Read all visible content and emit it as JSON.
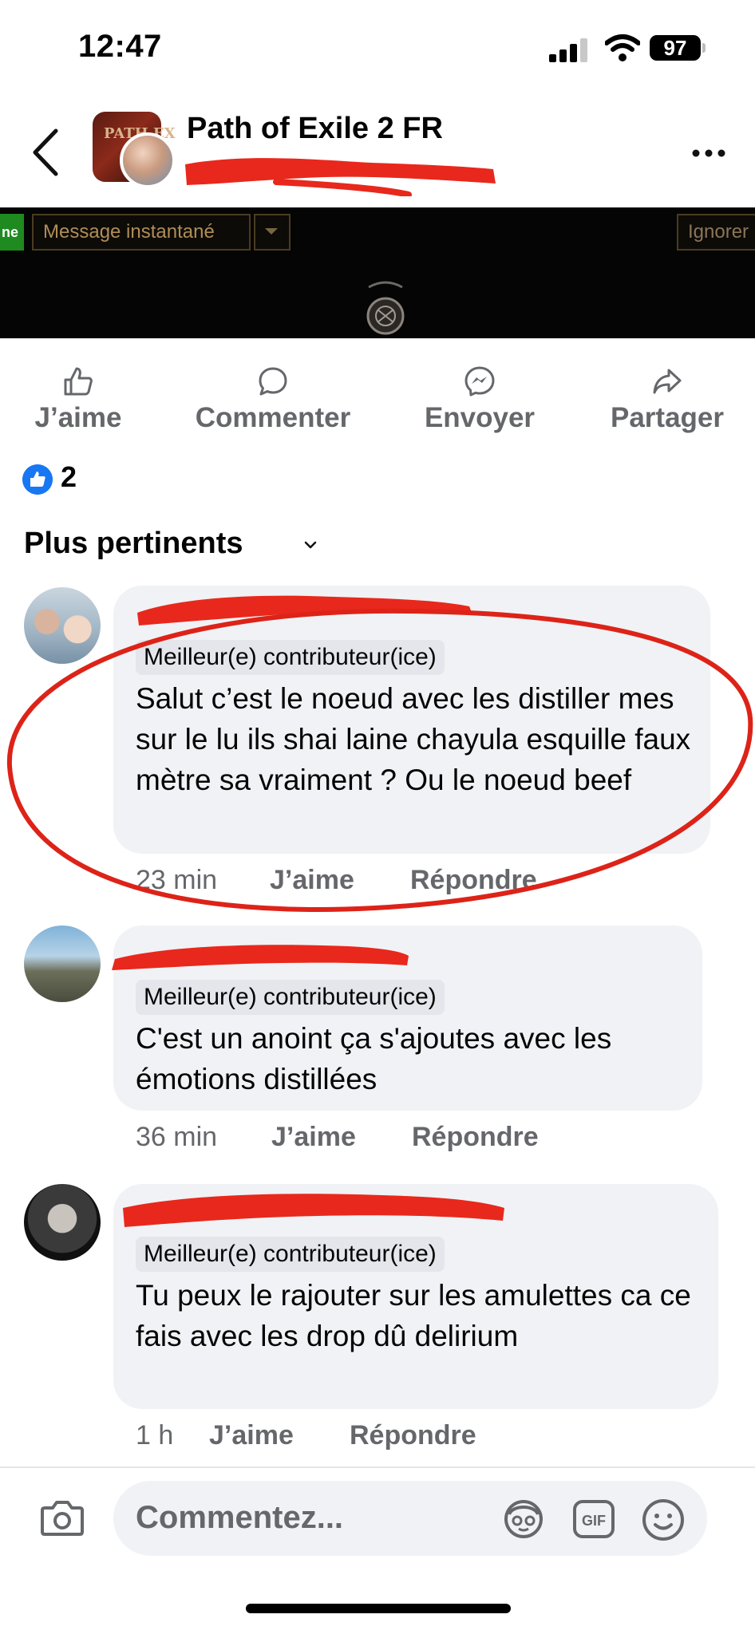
{
  "status": {
    "time": "12:47",
    "battery": "97"
  },
  "header": {
    "group_name": "Path of Exile 2 FR",
    "group_avatar_text": "PATH EX"
  },
  "banner": {
    "green_tab": "ne",
    "message_label": "Message instantané",
    "ignore_label": "Ignorer"
  },
  "actions": {
    "like": "J’aime",
    "comment": "Commenter",
    "send": "Envoyer",
    "share": "Partager"
  },
  "reactions": {
    "count": "2"
  },
  "sort": {
    "label": "Plus pertinents"
  },
  "comments": [
    {
      "badge": "Meilleur(e) contributeur(ice)",
      "text": "Salut c’est le noeud avec les distiller mes sur le lu ils shai laine chayula esquille faux mètre sa vraiment ? Ou le noeud beef",
      "time": "23 min",
      "like": "J’aime",
      "reply": "Répondre"
    },
    {
      "badge": "Meilleur(e) contributeur(ice)",
      "text": "C'est un anoint ça s'ajoutes avec les émotions distillées",
      "time": "36 min",
      "like": "J’aime",
      "reply": "Répondre"
    },
    {
      "badge": "Meilleur(e) contributeur(ice)",
      "text": "Tu peux le rajouter sur les amulettes ca ce fais avec les drop dû delirium",
      "time": "1 h",
      "like": "J’aime",
      "reply": "Répondre"
    }
  ],
  "composer": {
    "placeholder": "Commentez..."
  },
  "colors": {
    "accent": "#1877f2",
    "bubble": "#f0f2f5",
    "muted": "#65676b",
    "redaction": "#e8281c"
  },
  "icons": [
    "signal-icon",
    "wifi-icon",
    "back-icon",
    "more-icon",
    "like-icon",
    "comment-icon",
    "messenger-icon",
    "share-icon",
    "camera-icon",
    "avatar-sticker-icon",
    "gif-icon",
    "emoji-icon"
  ]
}
